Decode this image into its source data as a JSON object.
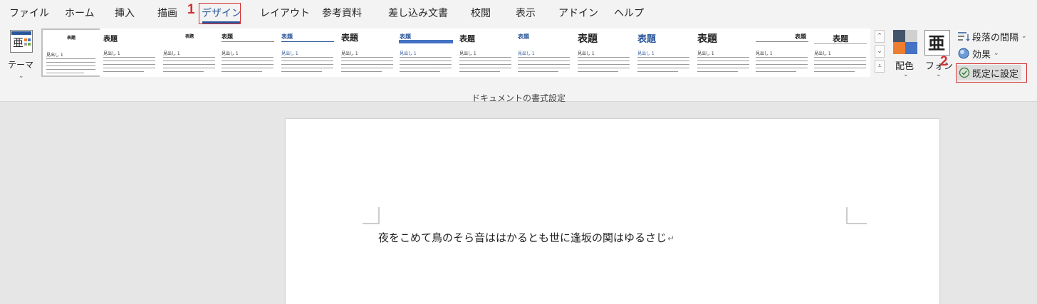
{
  "tabs": [
    "ファイル",
    "ホーム",
    "挿入",
    "描画",
    "デザイン",
    "レイアウト",
    "参考資料",
    "差し込み文書",
    "校閲",
    "表示",
    "アドイン",
    "ヘルプ"
  ],
  "annotations": {
    "step1": "1",
    "step2": "2",
    "color": "#d32f2f"
  },
  "ribbon": {
    "theme_label": "テーマ",
    "theme_icon_char": "亜",
    "color_label": "配色",
    "font_label": "フォント",
    "font_visible_label": "フォン",
    "font_icon_char": "亜",
    "paragraph_spacing": "段落の間隔",
    "effects": "効果",
    "set_default": "既定に設定",
    "group_label": "ドキュメントの書式設定"
  },
  "style_set": {
    "title": "表題",
    "heading": "見出し 1"
  },
  "accent_color": "#2b579a",
  "document": {
    "text": "夜をこめて鳥のそら音ははかるとも世に逢坂の関はゆるさじ",
    "paragraph_mark": "↵"
  }
}
